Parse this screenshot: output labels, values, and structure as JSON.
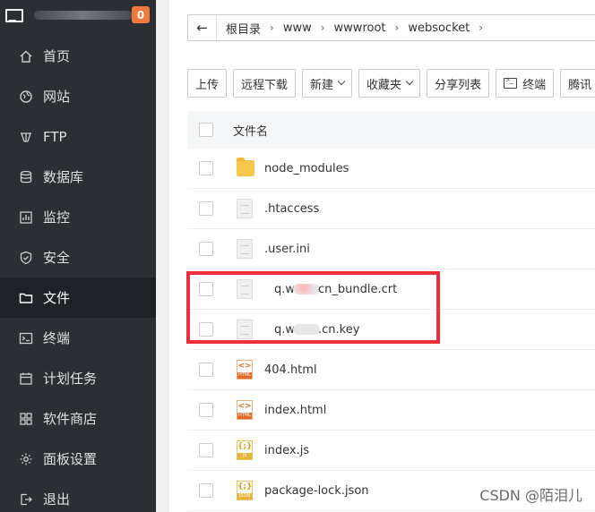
{
  "sidebar": {
    "badge": "0",
    "items": [
      {
        "label": "首页",
        "icon": "home-icon"
      },
      {
        "label": "网站",
        "icon": "globe-icon"
      },
      {
        "label": "FTP",
        "icon": "ftp-icon"
      },
      {
        "label": "数据库",
        "icon": "database-icon"
      },
      {
        "label": "监控",
        "icon": "monitor-chart-icon"
      },
      {
        "label": "安全",
        "icon": "shield-icon"
      },
      {
        "label": "文件",
        "icon": "folder-icon"
      },
      {
        "label": "终端",
        "icon": "terminal-icon"
      },
      {
        "label": "计划任务",
        "icon": "calendar-icon"
      },
      {
        "label": "软件商店",
        "icon": "grid-icon"
      },
      {
        "label": "面板设置",
        "icon": "gear-icon"
      },
      {
        "label": "退出",
        "icon": "logout-icon"
      }
    ],
    "active_index": 6
  },
  "breadcrumb": {
    "items": [
      "根目录",
      "www",
      "wwwroot",
      "websocket"
    ]
  },
  "toolbar": {
    "upload": "上传",
    "remote_download": "远程下载",
    "new": "新建",
    "favorites": "收藏夹",
    "share_list": "分享列表",
    "terminal": "终端",
    "tencent": "腾讯"
  },
  "table": {
    "header": "文件名",
    "rows": [
      {
        "name": "node_modules",
        "type": "folder"
      },
      {
        "name": ".htaccess",
        "type": "doc"
      },
      {
        "name": ".user.ini",
        "type": "doc"
      },
      {
        "name_prefix": "q.w",
        "name_suffix": "cn_bundle.crt",
        "type": "doc",
        "censored": true
      },
      {
        "name_prefix": "q.w",
        "name_suffix": ".cn.key",
        "type": "doc",
        "censored": true
      },
      {
        "name": "404.html",
        "type": "html"
      },
      {
        "name": "index.html",
        "type": "html"
      },
      {
        "name": "index.js",
        "type": "js"
      },
      {
        "name": "package-lock.json",
        "type": "json"
      }
    ]
  },
  "icon_text": {
    "code": "<>",
    "js_code": "{;}",
    "html": "HTML",
    "js": "JS",
    "json": "JSON"
  },
  "watermark": "CSDN @陌泪儿",
  "colors": {
    "sidebar_bg": "#2b2e33",
    "badge": "#f0793e",
    "highlight": "#ee2e3a",
    "folder": "#f7c74a"
  }
}
